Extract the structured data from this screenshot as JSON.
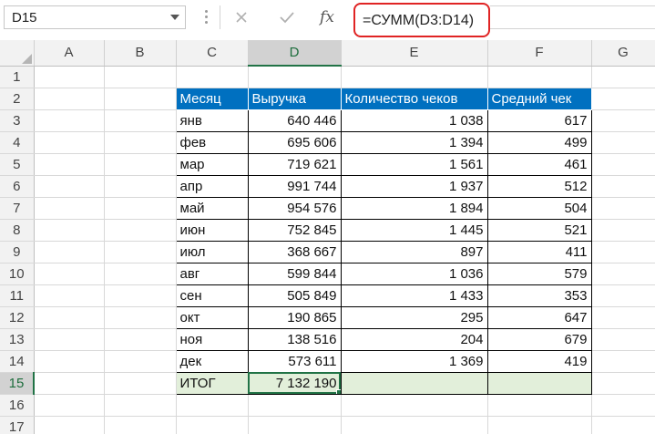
{
  "formula_bar": {
    "name_box": "D15",
    "formula": "=СУММ(D3:D14)",
    "fx_label": "fx",
    "cancel_icon": "cross-icon",
    "enter_icon": "checkmark-icon"
  },
  "columns": [
    "A",
    "B",
    "C",
    "D",
    "E",
    "F",
    "G"
  ],
  "rows": [
    "1",
    "2",
    "3",
    "4",
    "5",
    "6",
    "7",
    "8",
    "9",
    "10",
    "11",
    "12",
    "13",
    "14",
    "15",
    "16",
    "17"
  ],
  "selected": {
    "column": "D",
    "row": "15"
  },
  "table": {
    "headers": [
      "Месяц",
      "Выручка",
      "Количество чеков",
      "Средний чек"
    ],
    "rows": [
      [
        "янв",
        "640 446",
        "1 038",
        "617"
      ],
      [
        "фев",
        "695 606",
        "1 394",
        "499"
      ],
      [
        "мар",
        "719 621",
        "1 561",
        "461"
      ],
      [
        "апр",
        "991 744",
        "1 937",
        "512"
      ],
      [
        "май",
        "954 576",
        "1 894",
        "504"
      ],
      [
        "июн",
        "752 845",
        "1 445",
        "521"
      ],
      [
        "июл",
        "368 667",
        "897",
        "411"
      ],
      [
        "авг",
        "599 844",
        "1 036",
        "579"
      ],
      [
        "сен",
        "505 849",
        "1 433",
        "353"
      ],
      [
        "окт",
        "190 865",
        "295",
        "647"
      ],
      [
        "ноя",
        "138 516",
        "204",
        "679"
      ],
      [
        "дек",
        "573 611",
        "1 369",
        "419"
      ]
    ],
    "total_label": "ИТОГ",
    "total_value": "7 132 190"
  },
  "colors": {
    "header_fill": "#0070c0",
    "total_fill": "#e2efda",
    "selection": "#217346",
    "formula_highlight": "#e02424"
  }
}
